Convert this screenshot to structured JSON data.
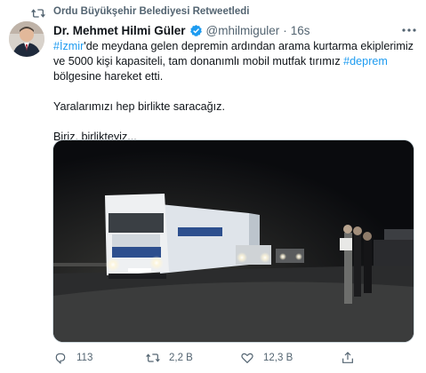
{
  "retweet": {
    "icon": "retweet-icon",
    "text": "Ordu Büyükşehir Belediyesi Retweetledi"
  },
  "author": {
    "name": "Dr. Mehmet Hilmi Güler",
    "handle": "@mhilmiguler",
    "separator": "·",
    "time": "16s",
    "verified": true
  },
  "tweet": {
    "line1_hashtag": "#İzmir",
    "line1_rest": "'de meydana gelen depremin ardından arama kurtarma ekiplerimiz ve 5000 kişi kapasiteli, tam donanımlı mobil mutfak tırımız ",
    "line1_hashtag2": "#deprem",
    "line1_tail": " bölgesine hareket etti.",
    "line2": "Yaralarımızı hep birlikte saracağız.",
    "line3": "Biriz, birlikteyiz..."
  },
  "media": {
    "truck_text_top": "FURKAN ESEN",
    "truck_text_main": "İZMİR",
    "trailer_text": "MOBİL MUTFAK"
  },
  "actions": {
    "reply_count": "113",
    "retweet_count": "2,2 B",
    "like_count": "12,3 B"
  },
  "colors": {
    "accent": "#1d9bf0",
    "muted": "#536471"
  }
}
